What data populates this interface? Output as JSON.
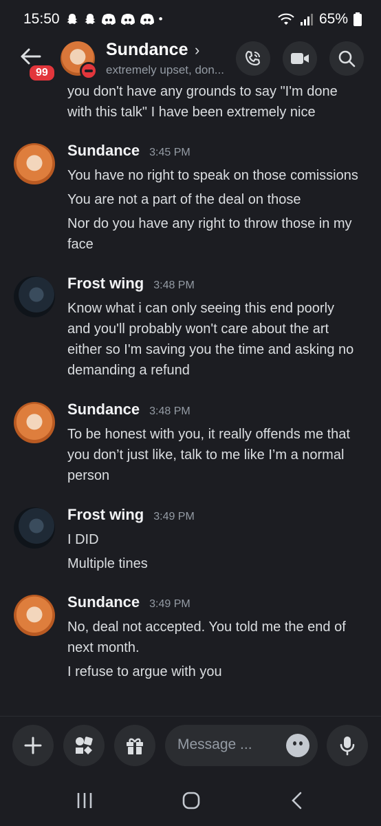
{
  "status_bar": {
    "time": "15:50",
    "notification_icons": [
      "snapchat-icon",
      "snapchat-icon",
      "discord-icon",
      "discord-icon",
      "discord-icon"
    ],
    "dot": "•",
    "battery": "65%"
  },
  "header": {
    "unread_badge": "99",
    "name": "Sundance",
    "chevron": "›",
    "status": "extremely upset, don..."
  },
  "continuation": [
    "you don't have any grounds to say \"I'm done",
    "with this talk\" I have been extremely nice"
  ],
  "messages": [
    {
      "author": "Sundance",
      "time": "3:45 PM",
      "lines": [
        "You have no right to speak on those comissions",
        "You are not a part of the deal on those",
        "Nor do you have any right to throw those in my",
        "face"
      ]
    },
    {
      "author": "Frost wing",
      "time": "3:48 PM",
      "lines": [
        "Know what i can only seeing this end poorly",
        "and you'll probably won't care about the art",
        "either so I'm saving you the time and asking no",
        "demanding a refund"
      ]
    },
    {
      "author": "Sundance",
      "time": "3:48 PM",
      "lines": [
        "To be honest with you, it really offends me that",
        "you don’t just like, talk to me like I’m a normal",
        "person"
      ]
    },
    {
      "author": "Frost wing",
      "time": "3:49 PM",
      "lines": [
        "I DID",
        "Multiple tines"
      ]
    },
    {
      "author": "Sundance",
      "time": "3:49 PM",
      "lines": [
        "No, deal not accepted. You told me the end of",
        "next month.",
        "I refuse to argue with you"
      ]
    }
  ],
  "composer": {
    "placeholder": "Message ..."
  },
  "colors": {
    "background": "#1c1d22",
    "button_bg": "#2b2d31",
    "badge_red": "#e2363c",
    "muted_text": "#949ba4"
  }
}
